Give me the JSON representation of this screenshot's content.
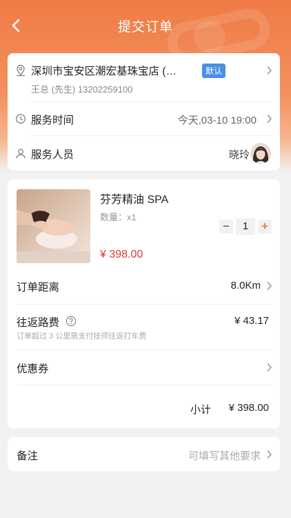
{
  "header": {
    "title": "提交订单"
  },
  "address": {
    "title": "深圳市宝安区潮宏基珠宝店 (…",
    "badge": "默认",
    "contact": "王总 (先生)  13202259100"
  },
  "service_time": {
    "label": "服务时间",
    "value": "今天,03-10 19:00"
  },
  "staff": {
    "label": "服务人员",
    "name": "晓玲"
  },
  "product": {
    "name": "芬芳精油 SPA",
    "quantity_label": "数量：x1",
    "quantity": "1",
    "price": "¥ 398.00",
    "minus": "−",
    "plus": "+"
  },
  "distance": {
    "label": "订单距离",
    "value": "8.0Km"
  },
  "travel_fee": {
    "label": "往返路费",
    "value": "¥ 43.17",
    "note": "订单超过 3 公里需支付技师往返打车费"
  },
  "coupon": {
    "label": "优惠券"
  },
  "subtotal": {
    "label": "小计",
    "value": "¥ 398.00"
  },
  "remark": {
    "label": "备注",
    "placeholder": "可填写其他要求"
  },
  "colors": {
    "accent": "#f07c3e",
    "price": "#d9383a",
    "badge": "#4a90e2"
  }
}
